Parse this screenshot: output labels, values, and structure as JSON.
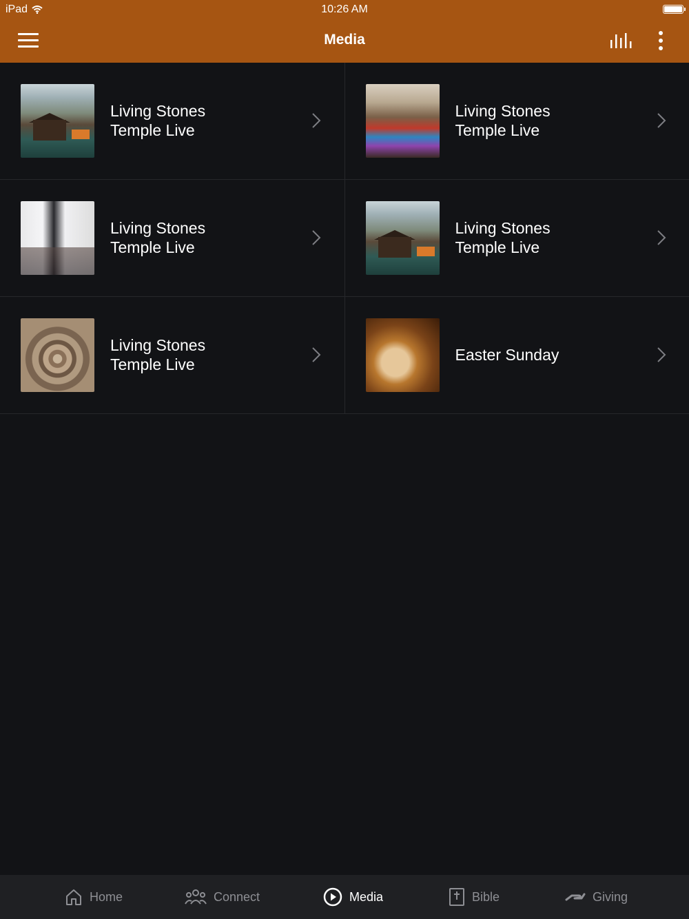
{
  "status_bar": {
    "carrier": "iPad",
    "time": "10:26 AM"
  },
  "header": {
    "title": "Media",
    "menu_icon": "hamburger-menu-icon",
    "audio_icon": "equalizer-bars-icon",
    "more_icon": "vertical-ellipsis-icon"
  },
  "media_items": [
    {
      "title": "Living Stones Temple Live",
      "thumbnail": "lake-cabin"
    },
    {
      "title": "Living Stones Temple Live",
      "thumbnail": "congregation"
    },
    {
      "title": "Living Stones Temple Live",
      "thumbnail": "choir"
    },
    {
      "title": "Living Stones Temple Live",
      "thumbnail": "lake-cabin"
    },
    {
      "title": "Living Stones Temple Live",
      "thumbnail": "tree-rings"
    },
    {
      "title": "Easter Sunday",
      "thumbnail": "empty-tomb"
    }
  ],
  "tab_bar": {
    "active": "Media",
    "tabs": [
      {
        "label": "Home",
        "icon": "house-icon"
      },
      {
        "label": "Connect",
        "icon": "people-icon"
      },
      {
        "label": "Media",
        "icon": "play-circle-icon"
      },
      {
        "label": "Bible",
        "icon": "bible-book-icon"
      },
      {
        "label": "Giving",
        "icon": "giving-hand-icon"
      }
    ]
  },
  "colors": {
    "header": "#a65512",
    "background": "#121316",
    "tab_bar": "#1f2023",
    "inactive_tab": "#8e8f94"
  }
}
